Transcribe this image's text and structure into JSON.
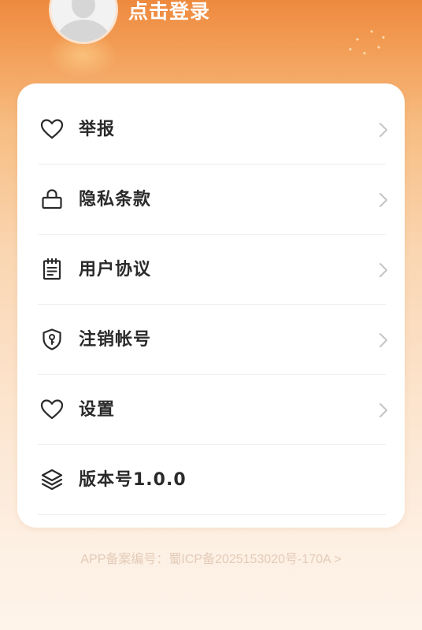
{
  "header": {
    "login_label": "点击登录"
  },
  "menu": {
    "items": [
      {
        "label": "举报",
        "icon": "heart-icon"
      },
      {
        "label": "隐私条款",
        "icon": "lock-icon"
      },
      {
        "label": "用户协议",
        "icon": "notepad-icon"
      },
      {
        "label": "注销帐号",
        "icon": "shield-key-icon"
      },
      {
        "label": "设置",
        "icon": "heart-icon"
      },
      {
        "label": "版本号1.0.0",
        "icon": "layers-icon"
      }
    ]
  },
  "footer": {
    "record_text": "APP备案编号：蜀ICP备2025153020号-170A >"
  },
  "colors": {
    "accent": "#ee8a3e",
    "text": "#2a2a2a",
    "chevron": "#c4c4c4",
    "record_text": "#e3cbb8"
  }
}
